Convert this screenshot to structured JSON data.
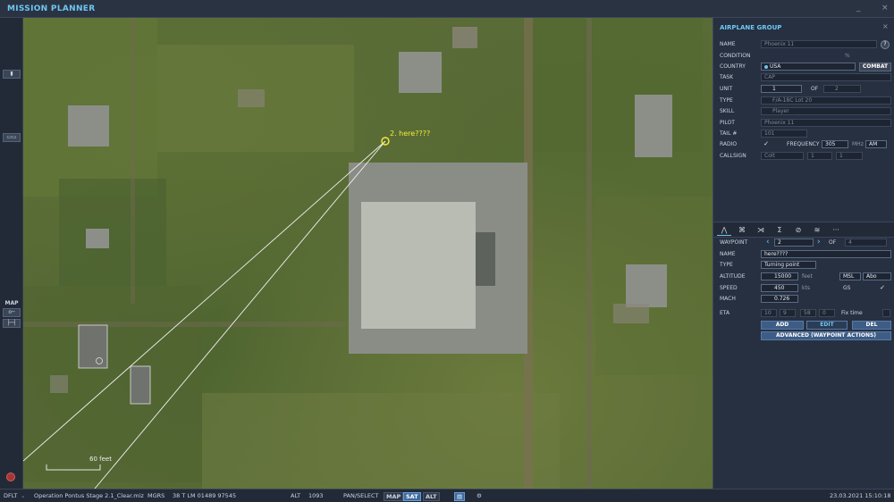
{
  "app": {
    "title": "MISSION PLANNER",
    "minimize": "_",
    "close": "×"
  },
  "left_toolbar": {
    "map_label": "MAP"
  },
  "map": {
    "waypoint_label": "2. here????",
    "scale_label": "60 feet"
  },
  "panel": {
    "title": "AIRPLANE GROUP",
    "close": "×",
    "name_label": "NAME",
    "name_value": "Phoenix 11",
    "help": "?",
    "condition_label": "CONDITION",
    "condition_value": "%",
    "country_label": "COUNTRY",
    "country_value": "USA",
    "combat_button": "COMBAT",
    "task_label": "TASK",
    "task_value": "CAP",
    "unit_label": "UNIT",
    "unit_value": "1",
    "of_label": "OF",
    "unit_of_value": "2",
    "type_label": "TYPE",
    "type_value": "F/A-18C Lot 20",
    "skill_label": "SKILL",
    "skill_value": "Player",
    "pilot_label": "PILOT",
    "pilot_value": "Phoenix 11",
    "tail_label": "TAIL #",
    "tail_value": "101",
    "radio_label": "RADIO",
    "frequency_label": "FREQUENCY",
    "frequency_value": "305",
    "mhz_label": "MHz",
    "modulation_value": "AM",
    "callsign_label": "CALLSIGN",
    "callsign_value": "Colt",
    "callsign_n1": "1",
    "callsign_n2": "1"
  },
  "waypoint": {
    "waypoint_label": "WAYPOINT",
    "waypoint_value": "2",
    "of_label": "OF",
    "of_value": "4",
    "name_label": "NAME",
    "name_value": "here????",
    "type_label": "TYPE",
    "type_value": "Turning point",
    "altitude_label": "ALTITUDE",
    "altitude_value": "15000",
    "altitude_unit": "feet",
    "alt_ref": "MSL",
    "alt_mode": "Abo",
    "speed_label": "SPEED",
    "speed_value": "450",
    "speed_unit": "kts",
    "gs_label": "GS",
    "mach_label": "MACH",
    "mach_value": "0.726",
    "eta_label": "ETA",
    "eta_d": "10",
    "eta_h": "9",
    "eta_m": "58",
    "eta_s": "0",
    "fix_time_label": "Fix time",
    "add_button": "ADD",
    "edit_button": "EDIT",
    "del_button": "DEL",
    "advanced_button": "ADVANCED (WAYPOINT ACTIONS)"
  },
  "status": {
    "profile": "DFLT",
    "file": "Operation Pontus Stage 2.1_Clear.miz",
    "coord_system": "MGRS",
    "coord_value": "38 T LM 01489 97545",
    "alt_label": "ALT",
    "alt_value": "1093",
    "pan_select": "PAN/SELECT",
    "map_btn": "MAP",
    "sat_btn": "SAT",
    "alt_btn": "ALT",
    "datetime": "23.03.2021 15:10:18"
  },
  "colors": {
    "accent": "#6ec6f2",
    "waypoint": "#f5ec3a",
    "button_blue": "#3d5c86"
  }
}
